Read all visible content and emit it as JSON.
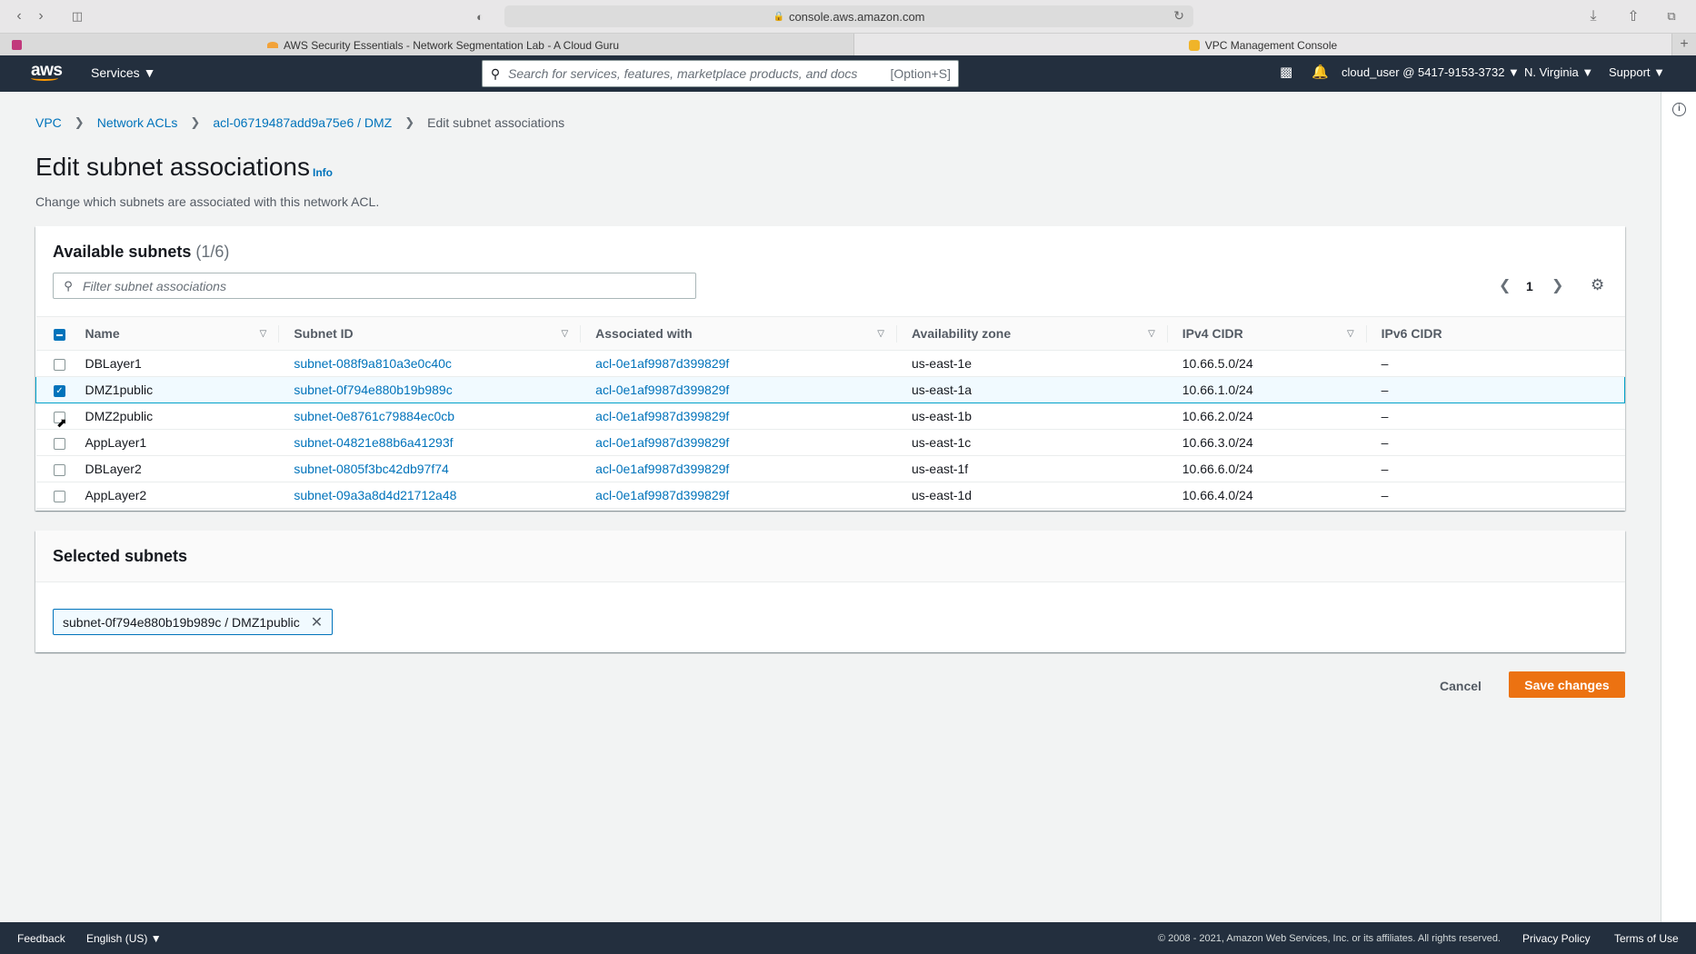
{
  "browser": {
    "url": "console.aws.amazon.com",
    "tabs": [
      {
        "title": "AWS Security Essentials - Network Segmentation Lab - A Cloud Guru",
        "active": false
      },
      {
        "title": "VPC Management Console",
        "active": true
      }
    ]
  },
  "nav": {
    "logo": "aws",
    "services": "Services ▼",
    "search_placeholder": "Search for services, features, marketplace products, and docs",
    "search_shortcut": "[Option+S]",
    "account": "cloud_user @ 5417-9153-3732 ▼",
    "region": "N. Virginia ▼",
    "support": "Support ▼"
  },
  "breadcrumb": {
    "items": [
      "VPC",
      "Network ACLs",
      "acl-06719487add9a75e6 / DMZ"
    ],
    "current": "Edit subnet associations"
  },
  "page": {
    "title": "Edit subnet associations",
    "info": "Info",
    "description": "Change which subnets are associated with this network ACL."
  },
  "available": {
    "title": "Available subnets",
    "count": "(1/6)",
    "filter_placeholder": "Filter subnet associations",
    "page_number": "1",
    "columns": [
      "Name",
      "Subnet ID",
      "Associated with",
      "Availability zone",
      "IPv4 CIDR",
      "IPv6 CIDR"
    ],
    "rows": [
      {
        "name": "DBLayer1",
        "subnet_id": "subnet-088f9a810a3e0c40c",
        "associated": "acl-0e1af9987d399829f",
        "az": "us-east-1e",
        "ipv4": "10.66.5.0/24",
        "ipv6": "–",
        "checked": false
      },
      {
        "name": "DMZ1public",
        "subnet_id": "subnet-0f794e880b19b989c",
        "associated": "acl-0e1af9987d399829f",
        "az": "us-east-1a",
        "ipv4": "10.66.1.0/24",
        "ipv6": "–",
        "checked": true
      },
      {
        "name": "DMZ2public",
        "subnet_id": "subnet-0e8761c79884ec0cb",
        "associated": "acl-0e1af9987d399829f",
        "az": "us-east-1b",
        "ipv4": "10.66.2.0/24",
        "ipv6": "–",
        "checked": false
      },
      {
        "name": "AppLayer1",
        "subnet_id": "subnet-04821e88b6a41293f",
        "associated": "acl-0e1af9987d399829f",
        "az": "us-east-1c",
        "ipv4": "10.66.3.0/24",
        "ipv6": "–",
        "checked": false
      },
      {
        "name": "DBLayer2",
        "subnet_id": "subnet-0805f3bc42db97f74",
        "associated": "acl-0e1af9987d399829f",
        "az": "us-east-1f",
        "ipv4": "10.66.6.0/24",
        "ipv6": "–",
        "checked": false
      },
      {
        "name": "AppLayer2",
        "subnet_id": "subnet-09a3a8d4d21712a48",
        "associated": "acl-0e1af9987d399829f",
        "az": "us-east-1d",
        "ipv4": "10.66.4.0/24",
        "ipv6": "–",
        "checked": false
      }
    ]
  },
  "selected": {
    "title": "Selected subnets",
    "token": "subnet-0f794e880b19b989c / DMZ1public"
  },
  "actions": {
    "cancel": "Cancel",
    "save": "Save changes"
  },
  "footer": {
    "feedback": "Feedback",
    "language": "English (US) ▼",
    "copyright": "© 2008 - 2021, Amazon Web Services, Inc. or its affiliates. All rights reserved.",
    "privacy": "Privacy Policy",
    "terms": "Terms of Use"
  },
  "colors": {
    "nav_bg": "#232f3e",
    "link": "#0073bb",
    "primary_button": "#ec7211",
    "selected_row": "#f1faff"
  }
}
